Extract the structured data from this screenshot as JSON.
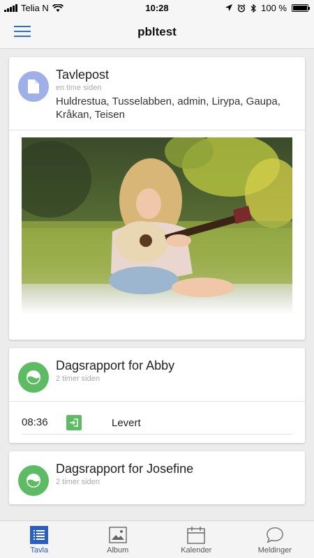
{
  "status_bar": {
    "carrier": "Telia N",
    "time": "10:28",
    "battery": "100 %"
  },
  "header": {
    "title": "pbltest"
  },
  "feed": {
    "cards": [
      {
        "title": "Tavlepost",
        "time": "en time siden",
        "subtitle": "Huldrestua, Tusselabben, admin, Lirypa, Gaupa, Kråkan, Teisen",
        "icon": "document-icon"
      },
      {
        "title": "Dagsrapport for Abby",
        "time": "2 timer siden",
        "icon": "report-icon",
        "entry": {
          "time": "08:36",
          "label": "Levert",
          "icon": "checkin-icon"
        }
      },
      {
        "title": "Dagsrapport for Josefine",
        "time": "2 timer siden",
        "icon": "report-icon"
      }
    ]
  },
  "tabs": [
    {
      "label": "Tavla",
      "icon": "list-icon",
      "active": true
    },
    {
      "label": "Album",
      "icon": "image-icon",
      "active": false
    },
    {
      "label": "Kalender",
      "icon": "calendar-icon",
      "active": false
    },
    {
      "label": "Meldinger",
      "icon": "chat-icon",
      "active": false
    }
  ],
  "colors": {
    "accent": "#2a5fc0",
    "green": "#5dbb63",
    "doc_avatar": "#9fb0e8"
  }
}
